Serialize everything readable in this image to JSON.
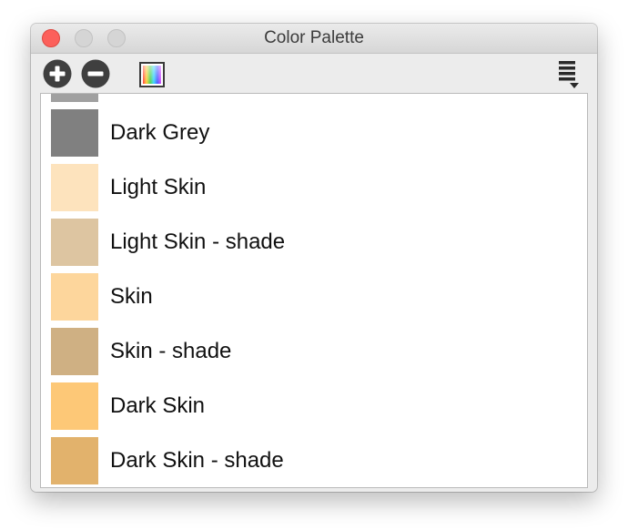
{
  "window": {
    "title": "Color Palette"
  },
  "toolbar": {
    "add_icon": "plus-circle-icon",
    "remove_icon": "minus-circle-icon",
    "picker_icon": "color-picker-icon",
    "menu_icon": "list-menu-icon"
  },
  "colors": {
    "close": "#fc605b",
    "inactive_button": "#d5d5d5"
  },
  "palette": {
    "partial_item_color": "#a0a0a0",
    "items": [
      {
        "label": "Dark Grey",
        "color": "#808080"
      },
      {
        "label": "Light Skin",
        "color": "#fde3bd"
      },
      {
        "label": "Light Skin - shade",
        "color": "#ddc5a1"
      },
      {
        "label": "Skin",
        "color": "#fdd69c"
      },
      {
        "label": "Skin - shade",
        "color": "#cfb083"
      },
      {
        "label": "Dark Skin",
        "color": "#fdc877"
      },
      {
        "label": "Dark Skin - shade",
        "color": "#e2b26c"
      }
    ]
  }
}
